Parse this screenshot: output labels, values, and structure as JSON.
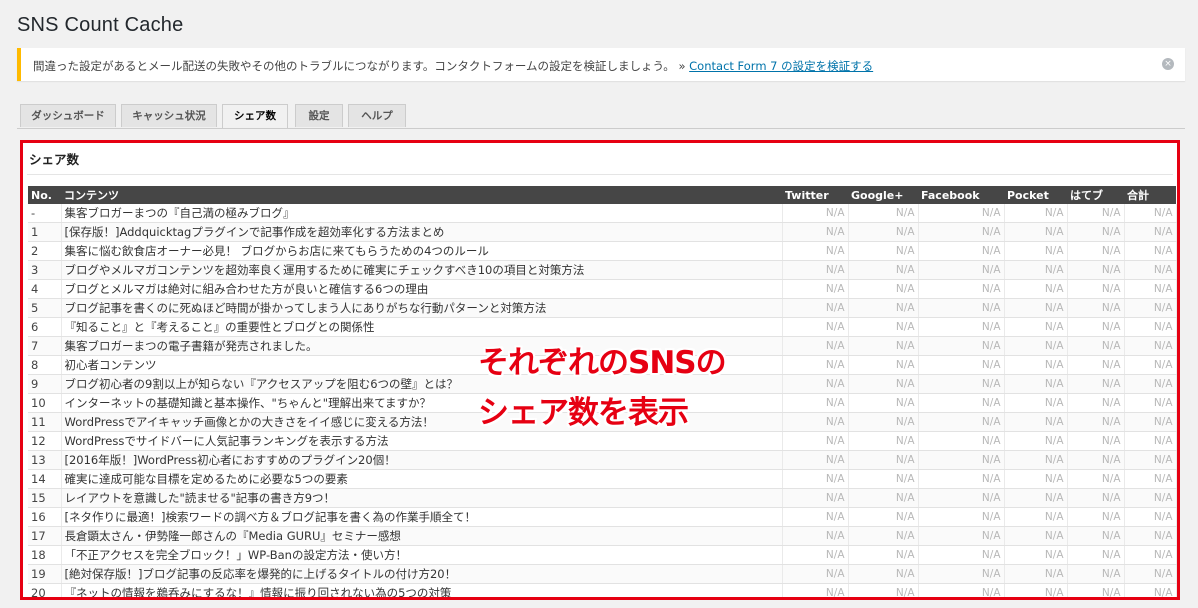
{
  "page_title": "SNS Count Cache",
  "notice": {
    "text": "間違った設定があるとメール配送の失敗やその他のトラブルにつながります。コンタクトフォームの設定を検証しましょう。 » ",
    "link": "Contact Form 7 の設定を検証する",
    "dismiss_icon": "×"
  },
  "tabs": [
    {
      "label": "ダッシュボード"
    },
    {
      "label": "キャッシュ状況"
    },
    {
      "label": "シェア数"
    },
    {
      "label": "設定"
    },
    {
      "label": "ヘルプ"
    }
  ],
  "panel": {
    "title": "シェア数",
    "columns": [
      "No.",
      "コンテンツ",
      "Twitter",
      "Google+",
      "Facebook",
      "Pocket",
      "はてブ",
      "合計"
    ],
    "na": "N/A",
    "rows": [
      {
        "no": "-",
        "title": "集客ブロガーまつの『自己満の極みブログ』"
      },
      {
        "no": "1",
        "title": "[保存版！]Addquicktagプラグインで記事作成を超効率化する方法まとめ"
      },
      {
        "no": "2",
        "title": "集客に悩む飲食店オーナー必見！ ブログからお店に来てもらうための4つのルール"
      },
      {
        "no": "3",
        "title": "ブログやメルマガコンテンツを超効率良く運用するために確実にチェックすべき10の項目と対策方法"
      },
      {
        "no": "4",
        "title": "ブログとメルマガは絶対に組み合わせた方が良いと確信する6つの理由"
      },
      {
        "no": "5",
        "title": "ブログ記事を書くのに死ぬほど時間が掛かってしまう人にありがちな行動パターンと対策方法"
      },
      {
        "no": "6",
        "title": "『知ること』と『考えること』の重要性とブログとの関係性"
      },
      {
        "no": "7",
        "title": "集客ブロガーまつの電子書籍が発売されました。"
      },
      {
        "no": "8",
        "title": "初心者コンテンツ"
      },
      {
        "no": "9",
        "title": "ブログ初心者の9割以上が知らない『アクセスアップを阻む6つの壁』とは？"
      },
      {
        "no": "10",
        "title": "インターネットの基礎知識と基本操作、\"ちゃんと\"理解出来てますか？"
      },
      {
        "no": "11",
        "title": "WordPressでアイキャッチ画像とかの大きさをイイ感じに変える方法！"
      },
      {
        "no": "12",
        "title": "WordPressでサイドバーに人気記事ランキングを表示する方法"
      },
      {
        "no": "13",
        "title": "[2016年版！]WordPress初心者におすすめのプラグイン20個！"
      },
      {
        "no": "14",
        "title": "確実に達成可能な目標を定めるために必要な5つの要素"
      },
      {
        "no": "15",
        "title": "レイアウトを意識した\"読ませる\"記事の書き方9つ！"
      },
      {
        "no": "16",
        "title": "[ネタ作りに最適！]検索ワードの調べ方＆ブログ記事を書く為の作業手順全て！"
      },
      {
        "no": "17",
        "title": "長倉顕太さん・伊勢隆一郎さんの『Media GURU』セミナー感想"
      },
      {
        "no": "18",
        "title": "「不正アクセスを完全ブロック！」WP-Banの設定方法・使い方！"
      },
      {
        "no": "19",
        "title": "[絶対保存版！]ブログ記事の反応率を爆発的に上げるタイトルの付け方20！"
      },
      {
        "no": "20",
        "title": "『ネットの情報を鵜呑みにするな！』情報に振り回されない為の5つの対策"
      }
    ]
  },
  "overlay": {
    "line1": "それぞれのSNSの",
    "line2": "シェア数を表示"
  },
  "colors": {
    "accent": "#e60012",
    "notice": "#ffba00",
    "link": "#0073aa",
    "header": "#464646"
  }
}
